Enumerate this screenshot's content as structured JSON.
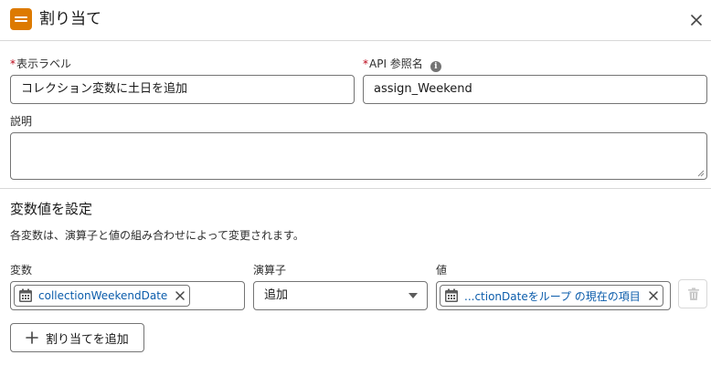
{
  "header": {
    "title": "割り当て"
  },
  "form": {
    "label_field": {
      "label": "表示ラベル",
      "required_mark": "*",
      "value": "コレクション変数に土日を追加"
    },
    "api_field": {
      "label": "API 参照名",
      "required_mark": "*",
      "value": "assign_Weekend"
    },
    "description_field": {
      "label": "説明",
      "value": ""
    }
  },
  "section": {
    "title": "変数値を設定",
    "description": "各変数は、演算子と値の組み合わせによって変更されます。"
  },
  "assignment": {
    "variable_label": "変数",
    "operator_label": "演算子",
    "value_label": "値",
    "variable_pill": "collectionWeekendDate",
    "operator_value": "追加",
    "value_pill": "...ctionDateをループ の現在の項目"
  },
  "add_button_label": "割り当てを追加",
  "colors": {
    "accent": "#dd7a01",
    "link": "#0b5cab",
    "required": "#ba0517"
  }
}
